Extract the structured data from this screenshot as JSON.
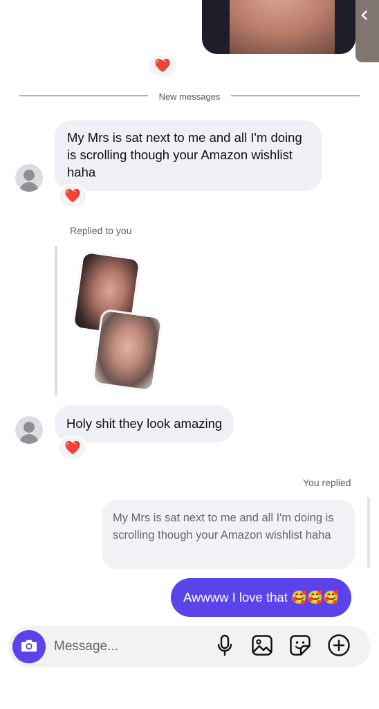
{
  "top_reaction": {
    "emoji": "❤️"
  },
  "divider": {
    "label": "New messages"
  },
  "messages": [
    {
      "from": "them",
      "text": "My Mrs is sat next to me and all I'm doing is scrolling though your Amazon wishlist haha",
      "reaction": "❤️"
    },
    {
      "from": "them",
      "meta": "Replied to you",
      "text": "Holy shit they look amazing",
      "reaction": "❤️"
    },
    {
      "from": "me",
      "meta": "You replied",
      "quoted": "My Mrs is sat next to me and all I'm doing is scrolling though your Amazon wishlist haha",
      "text": "Awwww I love that",
      "emojis": "🥰🥰🥰"
    }
  ],
  "composer": {
    "placeholder": "Message..."
  },
  "colors": {
    "accent": "#5a43ea",
    "bubble_in": "#eff0f5",
    "reaction_heart": "#e0242f"
  },
  "icons": [
    "chevron-left-icon",
    "camera-icon",
    "microphone-icon",
    "image-icon",
    "sticker-icon",
    "plus-circle-icon",
    "heart-icon"
  ]
}
